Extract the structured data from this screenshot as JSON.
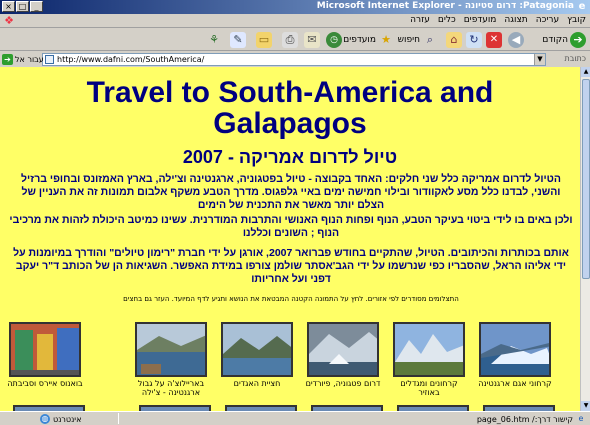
{
  "window": {
    "title": "Patagonia: דרום סטיונה - Microsoft Internet Explorer",
    "buttons": {
      "min": "_",
      "max": "□",
      "close": "×"
    }
  },
  "menubar": {
    "items": [
      "קובץ",
      "עריכה",
      "תצוגה",
      "מועדפים",
      "כלים",
      "עזרה"
    ]
  },
  "toolbar": {
    "back_label": "הקודם",
    "search_label": "חיפוש",
    "favorites_label": "מועדפים"
  },
  "addressbar": {
    "label": "כתובת",
    "url": "http://www.dafni.com/SouthAmerica/",
    "go_label": "עבור אל"
  },
  "content": {
    "title_en": "Travel to South-America and Galapagos",
    "title_he": "טיול לדרום אמריקה - 2007",
    "para1": "הטיול לדרום אמריקה כלל שני חלקים: האחד בקבוצה - טיול בפטגוניה, ארגנטינה וצ'ילה, בארץ האמזונס ובחופי ברזיל והשני, לבדנו כלל מסע לאקוודור ובילוי חמישה ימים באיי גלפגוס. מדרך הטבע משקף אלבום תמונות זה את העניין של הצלם יותר מאשר את התכנית של הימים",
    "para2": "ולכן באים בו לידי ביטוי בעיקר הטבע, הנוף ופחות הנוף האנושי והתרבות המודרנית. עשינו כמיטב היכולת לזהות את מרכיבי הנוף ; השונים וכללנו",
    "para3": "אותם בכותרות והכיתובים. הטיול, שהתקיים בחודש פברואר 2007, אורגן על ידי חברת \"רימון טיולים\" והודרך במיומנות על ידי אליהו הראל, שהסבריו כפי שנרשמו על ידי הגב'אסתר שולמן צורפו במידת האפשר. השגיאות הן של הכותב ד\"ר יעקב דפני ועל אחריותו",
    "note": "התצלומים מסודרים לפי אזורים. לחץ על התמונה הקטנה המבטאת את הנושא ותגיע לדף המיועד. העזר גם בחצים",
    "thumbnails": [
      {
        "caption": "קרחוני אגם ארגנטינה"
      },
      {
        "caption": "קרחונים ומגדלים באוזיר"
      },
      {
        "caption": "דרום פטגוניה, פיורדים"
      },
      {
        "caption": "חציית האגדים"
      },
      {
        "caption": "באריילוצ'ה על גבול ארגנטינה - צ'ילה"
      },
      {
        "caption": "בואנוס איירס וסביבתה"
      }
    ]
  },
  "statusbar": {
    "text": "קישור דרך:/ page_06.htm",
    "zone": "אינטרנט"
  },
  "colors": {
    "page_bg": "#ffff66",
    "heading": "#000080",
    "titlebar_start": "#0a246a"
  }
}
